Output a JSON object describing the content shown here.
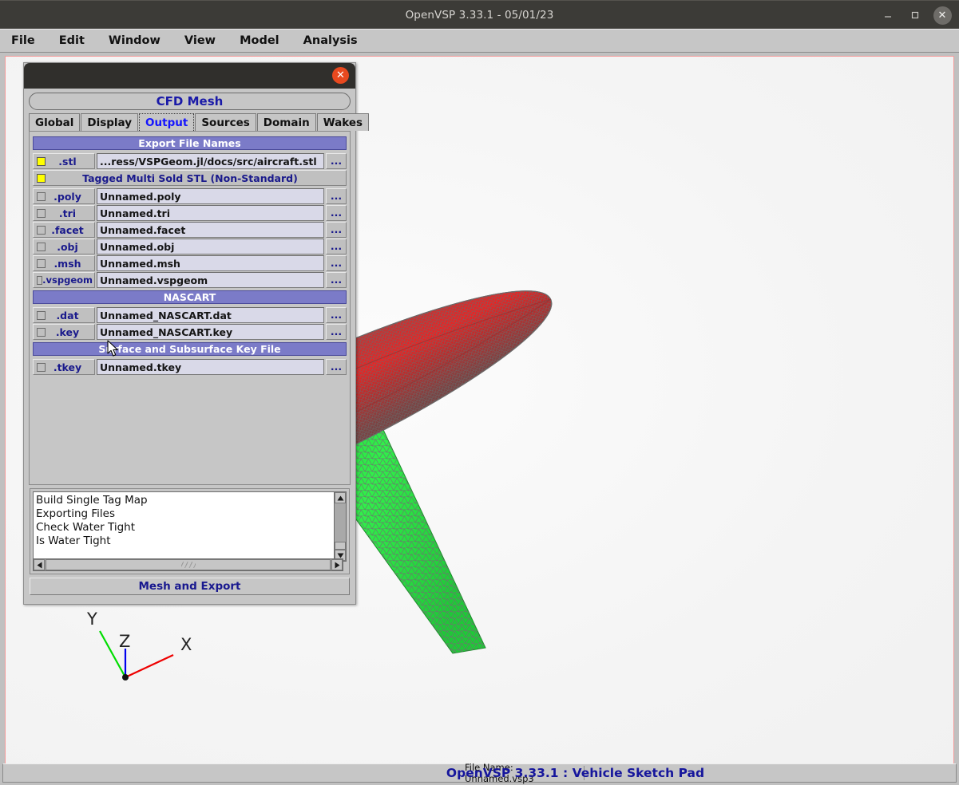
{
  "window": {
    "title": "OpenVSP 3.33.1 - 05/01/23",
    "minimize_icon": "minimize-icon",
    "maximize_icon": "maximize-icon",
    "close_icon": "close-icon",
    "close_glyph": "✕"
  },
  "menubar": {
    "items": [
      {
        "label": "File"
      },
      {
        "label": "Edit"
      },
      {
        "label": "Window"
      },
      {
        "label": "View"
      },
      {
        "label": "Model"
      },
      {
        "label": "Analysis"
      }
    ]
  },
  "dialog": {
    "title": "CFD Mesh",
    "close_glyph": "✕",
    "tabs": [
      {
        "label": "Global",
        "active": false
      },
      {
        "label": "Display",
        "active": false
      },
      {
        "label": "Output",
        "active": true
      },
      {
        "label": "Sources",
        "active": false
      },
      {
        "label": "Domain",
        "active": false
      },
      {
        "label": "Wakes",
        "active": false
      }
    ],
    "sections": [
      {
        "title": "Export File Names"
      },
      {
        "title": "NASCART"
      },
      {
        "title": "Surface and Subsurface Key File"
      }
    ],
    "export_rows": [
      {
        "ext": ".stl",
        "checked": true,
        "path": "...ress/VSPGeom.jl/docs/src/aircraft.stl",
        "browse": "..."
      },
      {
        "ext": ".poly",
        "checked": false,
        "path": "Unnamed.poly",
        "browse": "..."
      },
      {
        "ext": ".tri",
        "checked": false,
        "path": "Unnamed.tri",
        "browse": "..."
      },
      {
        "ext": ".facet",
        "checked": false,
        "path": "Unnamed.facet",
        "browse": "..."
      },
      {
        "ext": ".obj",
        "checked": false,
        "path": "Unnamed.obj",
        "browse": "..."
      },
      {
        "ext": ".msh",
        "checked": false,
        "path": "Unnamed.msh",
        "browse": "..."
      },
      {
        "ext": ".vspgeom",
        "checked": false,
        "path": "Unnamed.vspgeom",
        "browse": "..."
      }
    ],
    "tagged_multi_solid": {
      "label": "Tagged Multi Sold STL (Non-Standard)",
      "checked": true
    },
    "nascart_rows": [
      {
        "ext": ".dat",
        "checked": false,
        "path": "Unnamed_NASCART.dat",
        "browse": "..."
      },
      {
        "ext": ".key",
        "checked": false,
        "path": "Unnamed_NASCART.key",
        "browse": "..."
      }
    ],
    "key_file_rows": [
      {
        "ext": ".tkey",
        "checked": false,
        "path": "Unnamed.tkey",
        "browse": "..."
      }
    ],
    "log_lines": [
      "Build Single Tag Map",
      "Exporting Files",
      "Check Water Tight",
      "Is Water Tight"
    ],
    "mesh_export_label": "Mesh and Export"
  },
  "viewport": {
    "axes": [
      {
        "label": "Y",
        "color": "#00dd00"
      },
      {
        "label": "Z",
        "color": "#0000ee"
      },
      {
        "label": "X",
        "color": "#ee0000"
      }
    ],
    "model_colors": {
      "fuselage": "#e03030",
      "vertical_tail": "#f2ef1e",
      "wing": "#28e040",
      "mesh_lines": "#707070"
    }
  },
  "statusbar": {
    "file_name": "File Name: Unnamed.vsp3",
    "brand": "OpenVSP 3.33.1 : Vehicle Sketch Pad"
  }
}
